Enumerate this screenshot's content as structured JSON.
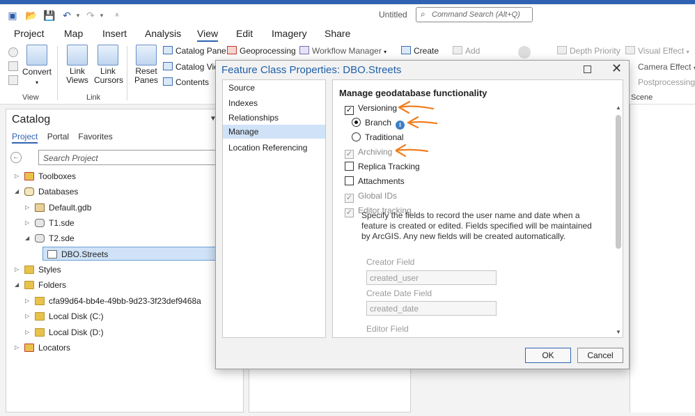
{
  "app": {
    "title": "Untitled",
    "command_search_placeholder": "Command Search (Alt+Q)"
  },
  "ribbon_tabs": [
    "Project",
    "Map",
    "Insert",
    "Analysis",
    "View",
    "Edit",
    "Imagery",
    "Share"
  ],
  "active_tab": "View",
  "ribbon": {
    "convert": "Convert",
    "link_views": "Link Views",
    "link_cursors": "Link Cursors",
    "reset_panes": "Reset Panes",
    "catalog_pane": "Catalog Pane",
    "catalog_view": "Catalog Vie",
    "contents": "Contents",
    "geoprocessing": "Geoprocessing",
    "workflow_manager": "Workflow Manager",
    "create": "Create",
    "add": "Add",
    "depth_priority": "Depth Priority",
    "visual_effect": "Visual Effect",
    "camera_effect": "Camera Effect",
    "postprocessing": "Postprocessing E",
    "group_view": "View",
    "group_link": "Link",
    "group_scene": "Scene"
  },
  "catalog": {
    "title": "Catalog",
    "tabs": [
      "Project",
      "Portal",
      "Favorites"
    ],
    "search_placeholder": "Search Project",
    "tree": [
      {
        "label": "Toolboxes"
      },
      {
        "label": "Databases"
      },
      {
        "label": "Default.gdb"
      },
      {
        "label": "T1.sde"
      },
      {
        "label": "T2.sde"
      },
      {
        "label": "DBO.Streets"
      },
      {
        "label": "Styles"
      },
      {
        "label": "Folders"
      },
      {
        "label": "cfa99d64-bb4e-49bb-9d23-3f23def9468a"
      },
      {
        "label": "Local Disk (C:)"
      },
      {
        "label": "Local Disk (D:)"
      },
      {
        "label": "Locators"
      }
    ]
  },
  "dialog": {
    "title": "Feature Class Properties: DBO.Streets",
    "nav": [
      "Source",
      "Indexes",
      "Relationships",
      "Manage",
      "Location Referencing"
    ],
    "selected_nav": "Manage",
    "section_title": "Manage geodatabase functionality",
    "options": {
      "versioning": "Versioning",
      "branch": "Branch",
      "traditional": "Traditional",
      "archiving": "Archiving",
      "replica_tracking": "Replica Tracking",
      "attachments": "Attachments",
      "global_ids": "Global IDs",
      "editor_tracking": "Editor tracking"
    },
    "description": "Specify the fields to record the user name and date when a feature is created or edited. Fields specified will be maintained by ArcGIS. Any new fields will be created automatically.",
    "creator_field_label": "Creator Field",
    "creator_field_value": "created_user",
    "create_date_field_label": "Create Date Field",
    "create_date_field_value": "created_date",
    "editor_field_label": "Editor Field",
    "ok": "OK",
    "cancel": "Cancel"
  },
  "colors": {
    "accent": "#2f63b1",
    "annotation_arrow": "#f07e1e",
    "selection": "#cfe2f7"
  }
}
